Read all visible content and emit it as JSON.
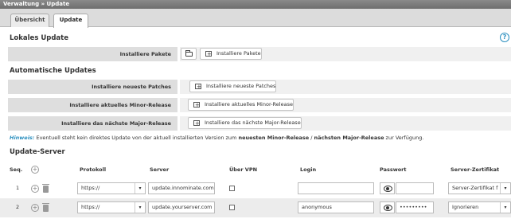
{
  "breadcrumb": "Verwaltung » Update",
  "tabs": [
    {
      "label": "Übersicht",
      "active": false
    },
    {
      "label": "Update",
      "active": true
    }
  ],
  "local_update": {
    "title": "Lokales Update",
    "label": "Installiere Pakete",
    "button": "Installiere Pakete"
  },
  "auto_updates": {
    "title": "Automatische Updates",
    "rows": [
      {
        "label": "Installiere neueste Patches",
        "button": "Installiere neueste Patches"
      },
      {
        "label": "Installiere aktuelles Minor-Release",
        "button": "Installiere aktuelles Minor-Release"
      },
      {
        "label": "Installiere das nächste Major-Release",
        "button": "Installiere das nächste Major-Release"
      }
    ]
  },
  "hint": {
    "prefix": "Hinweis:",
    "text1": " Eventuell steht kein direktes Update von der aktuell installierten Version zum ",
    "bold1": "neuesten Minor-Release",
    "sep": " / ",
    "bold2": "nächsten Major-Release",
    "text2": " zur Verfügung."
  },
  "update_server": {
    "title": "Update-Server",
    "columns": {
      "seq": "Seq.",
      "protocol": "Protokoll",
      "server": "Server",
      "vpn": "Über VPN",
      "login": "Login",
      "password": "Passwort",
      "cert": "Server-Zertifikat"
    },
    "rows": [
      {
        "seq": "1",
        "protocol": "https://",
        "server": "update.innominate.com",
        "login": "",
        "password": "",
        "cert": "Server-Zertifikat f"
      },
      {
        "seq": "2",
        "protocol": "https://",
        "server": "update.yourserver.com",
        "login": "anonymous",
        "password": "•••••••••",
        "cert": "Ignorieren"
      }
    ]
  },
  "colors": {
    "accent": "#2b8fbf",
    "label_bg": "#dedede",
    "value_bg": "#f0f0f0"
  }
}
